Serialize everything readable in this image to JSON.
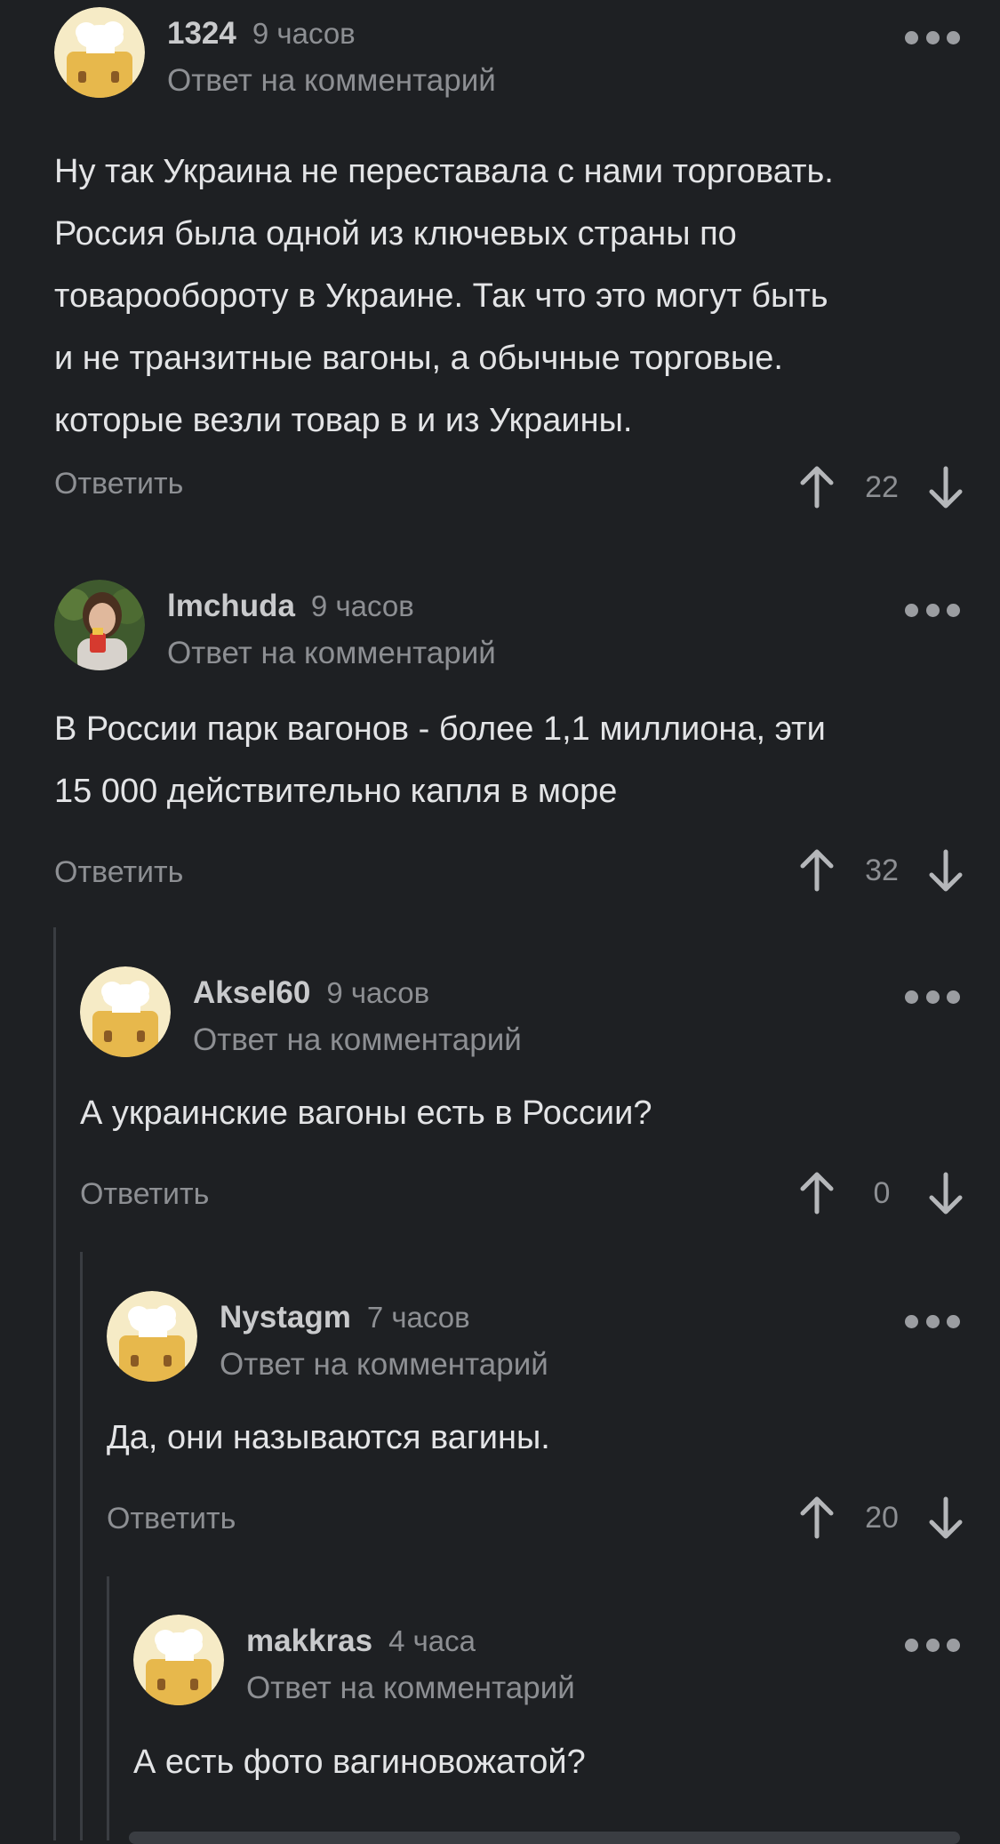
{
  "labels": {
    "reply_to": "Ответ на комментарий",
    "reply": "Ответить"
  },
  "comments": [
    {
      "author": "1324",
      "time": "9 часов",
      "text_lines": [
        "Ну так Украина не переставала с нами торговать.",
        "Россия была одной из ключевых страны по",
        "товарообороту в Украине. Так что это могут быть",
        "и не транзитные вагоны, а обычные торговые.",
        "которые везли товар в и из Украины."
      ],
      "score": "22",
      "avatar": "default-chef-avatar"
    },
    {
      "author": "lmchuda",
      "time": "9 часов",
      "text_lines": [
        "В России парк вагонов - более 1,1 миллиона, эти",
        "15 000 действительно капля в море"
      ],
      "score": "32",
      "avatar": "user-photo-avatar"
    },
    {
      "author": "Aksel60",
      "time": "9 часов",
      "text_lines": [
        "А украинские вагоны есть в России?"
      ],
      "score": "0",
      "avatar": "default-chef-avatar"
    },
    {
      "author": "Nystagm",
      "time": "7 часов",
      "text_lines": [
        "Да, они называются вагины."
      ],
      "score": "20",
      "avatar": "default-chef-avatar"
    },
    {
      "author": "makkras",
      "time": "4 часа",
      "text_lines": [
        "А есть фото вагиновожатой?"
      ],
      "avatar": "default-chef-avatar"
    }
  ],
  "colors": {
    "background": "#1e2023",
    "text": "#e3e4e6",
    "muted": "#8d8f93",
    "thread_line": "#3a3d42"
  }
}
